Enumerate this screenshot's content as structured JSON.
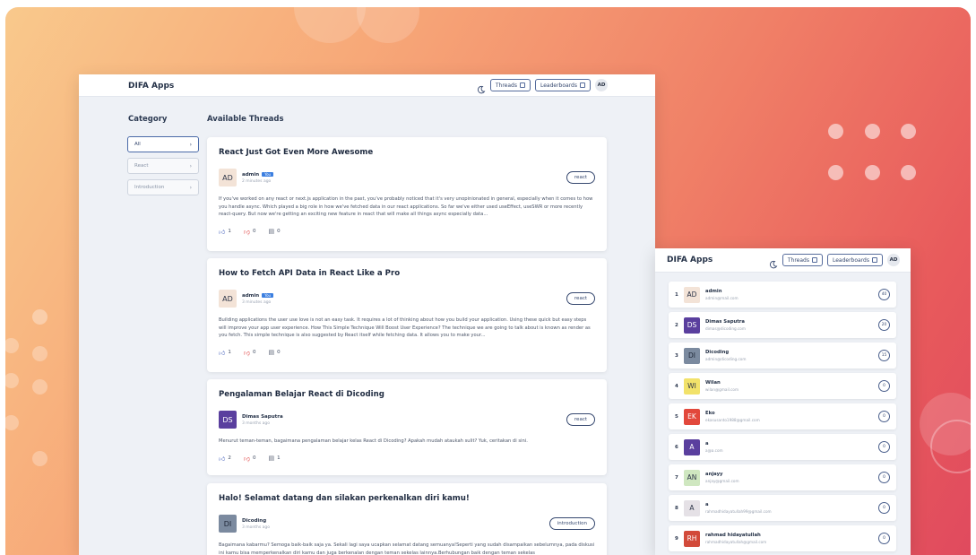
{
  "main_window": {
    "brand": "DIFA Apps",
    "nav": {
      "threads": "Threads",
      "leaderboards": "Leaderboards",
      "avatar": "AD"
    },
    "category_heading": "Category",
    "threads_heading": "Available Threads",
    "categories": [
      {
        "label": "All"
      },
      {
        "label": "React"
      },
      {
        "label": "Introduction"
      }
    ],
    "threads": [
      {
        "title": "React Just Got Even More Awesome",
        "author": {
          "initials": "AD",
          "name": "admin",
          "badge": "You",
          "time": "2 minutes ago",
          "avatar_bg": "#f3e3d7",
          "avatar_fg": "#2c3447"
        },
        "tag": "react",
        "body": "If you've worked on any react or next.js application in the past, you've probably noticed that it's very unopinionated in general, especially when it comes to how you handle async. Which played a big role in how we've fetched data in our react applications. So far we've either used useEffect, useSWR or more recently react-query. But now we're getting an exciting new feature in react that will make all things async especially data...",
        "upvotes": "1",
        "downvotes": "0",
        "comments": "0"
      },
      {
        "title": "How to Fetch API Data in React Like a Pro",
        "author": {
          "initials": "AD",
          "name": "admin",
          "badge": "You",
          "time": "3 minutes ago",
          "avatar_bg": "#f3e3d7",
          "avatar_fg": "#2c3447"
        },
        "tag": "react",
        "body": "Building applications the user use love is not an easy task. It requires a lot of thinking about how you build your application. Using these quick but easy steps will improve your app user experience. How This Simple Technique Will Boost User Experience? The technique we are going to talk about is known as render as you fetch. This simple technique is also suggested by React itself while fetching data. It allows you to make your...",
        "upvotes": "1",
        "downvotes": "0",
        "comments": "0"
      },
      {
        "title": "Pengalaman Belajar React di Dicoding",
        "author": {
          "initials": "DS",
          "name": "Dimas Saputra",
          "badge": "",
          "time": "3 months ago",
          "avatar_bg": "#5a3f9e",
          "avatar_fg": "#ffffff"
        },
        "tag": "react",
        "body": "Menurut teman-teman, bagaimana pengalaman belajar kelas React di Dicoding? Apakah mudah ataukah sulit? Yuk, ceritakan di sini.",
        "upvotes": "2",
        "downvotes": "0",
        "comments": "1"
      },
      {
        "title": "Halo! Selamat datang dan silakan perkenalkan diri kamu!",
        "author": {
          "initials": "DI",
          "name": "Dicoding",
          "badge": "",
          "time": "3 months ago",
          "avatar_bg": "#7b8a9f",
          "avatar_fg": "#1e2636"
        },
        "tag": "introduction",
        "body": "Bagaimana kabarmu? Semoga baik-baik saja ya. Sekali lagi saya ucapkan selamat datang semuanya!Seperti yang sudah disampaikan sebelumnya, pada diskusi ini kamu bisa memperkenalkan diri kamu dan juga berkenalan dengan teman sekelas lainnya.Berhubungan baik dengan teman sekelas",
        "upvotes": "",
        "downvotes": "",
        "comments": ""
      }
    ]
  },
  "leaderboard_window": {
    "brand": "DIFA Apps",
    "nav": {
      "threads": "Threads",
      "leaderboards": "Leaderboards",
      "avatar": "AD"
    },
    "rows": [
      {
        "rank": "1",
        "initials": "AD",
        "name": "admin",
        "email": "admin@mail.com",
        "score": "40",
        "avatar_bg": "#f3e3d7",
        "avatar_fg": "#2c3447"
      },
      {
        "rank": "2",
        "initials": "DS",
        "name": "Dimas Saputra",
        "email": "dimas@dicoding.com",
        "score": "20",
        "avatar_bg": "#5a3f9e",
        "avatar_fg": "#ffffff"
      },
      {
        "rank": "3",
        "initials": "DI",
        "name": "Dicoding",
        "email": "admin@dicoding.com",
        "score": "15",
        "avatar_bg": "#7b8a9f",
        "avatar_fg": "#1e2636"
      },
      {
        "rank": "4",
        "initials": "WI",
        "name": "Wilan",
        "email": "wilan@gmail.com",
        "score": "0",
        "avatar_bg": "#f2e26a",
        "avatar_fg": "#2c3447"
      },
      {
        "rank": "5",
        "initials": "EK",
        "name": "Eko",
        "email": "ekasusanto1988@gmail.com",
        "score": "0",
        "avatar_bg": "#e2483c",
        "avatar_fg": "#ffffff"
      },
      {
        "rank": "6",
        "initials": "A",
        "name": "a",
        "email": "a@a.com",
        "score": "0",
        "avatar_bg": "#5a3f9e",
        "avatar_fg": "#ffffff"
      },
      {
        "rank": "7",
        "initials": "AN",
        "name": "anjayy",
        "email": "anjay@gmail.com",
        "score": "0",
        "avatar_bg": "#cfe7c0",
        "avatar_fg": "#2c3447"
      },
      {
        "rank": "8",
        "initials": "A",
        "name": "a",
        "email": "rahmadhidayatullah99@gmail.com",
        "score": "0",
        "avatar_bg": "#e5e1e6",
        "avatar_fg": "#2c3447"
      },
      {
        "rank": "9",
        "initials": "RH",
        "name": "rahmad hidayatullah",
        "email": "rahmadhidayatullah@gmail.com",
        "score": "0",
        "avatar_bg": "#d24a3a",
        "avatar_fg": "#ffffff"
      }
    ]
  },
  "colors": {
    "accent": "#36486f",
    "upvote": "#3a58b8",
    "downvote": "#e34f4f",
    "background_gradient_start": "#f9c98c",
    "background_gradient_end": "#e04a5e"
  }
}
